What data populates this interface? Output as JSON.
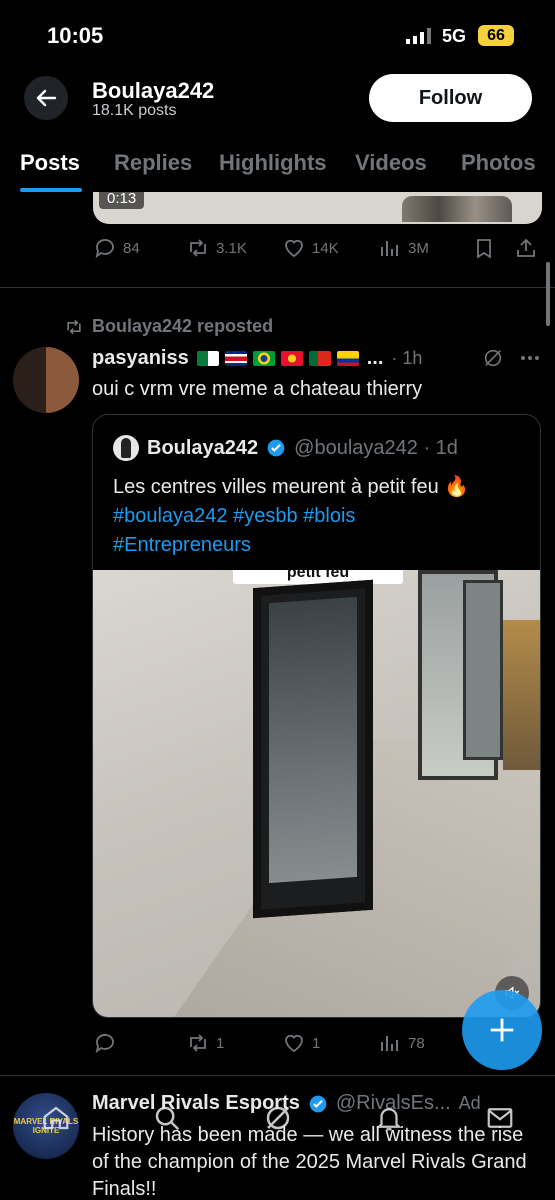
{
  "status_bar": {
    "time": "10:05",
    "network": "5G",
    "battery": "66"
  },
  "header": {
    "name": "Boulaya242",
    "posts": "18.1K posts",
    "follow_label": "Follow"
  },
  "tabs": [
    {
      "label": "Posts",
      "active": true
    },
    {
      "label": "Replies"
    },
    {
      "label": "Highlights"
    },
    {
      "label": "Videos"
    },
    {
      "label": "Photos"
    }
  ],
  "prev_post": {
    "media_duration": "0:13",
    "actions": {
      "replies": "84",
      "reposts": "3.1K",
      "likes": "14K",
      "views": "3M"
    }
  },
  "post": {
    "repost_label": "Boulaya242 reposted",
    "author_name": "pasyaniss",
    "author_ellipsis": "...",
    "time": "· 1h",
    "text": "oui c vrm vre meme a chateau thierry",
    "quote": {
      "name": "Boulaya242",
      "handle": "@boulaya242 · 1d",
      "text": "Les centres villes meurent à petit feu 🔥",
      "hashtags": "#boulaya242 #yesbb #blois",
      "hashtags2": "#Entrepreneurs",
      "media_caption": "petit feu"
    },
    "actions": {
      "reposts": "1",
      "likes": "1",
      "views": "78"
    }
  },
  "ad": {
    "avatar_text": "MARVEL RIVALS IGNITE",
    "name": "Marvel Rivals Esports",
    "handle": "@RivalsEs...",
    "label": "Ad",
    "text": "History has been made — we all witness the rise of the champion of the 2025 Marvel Rivals Grand Finals!!"
  },
  "colors": {
    "accent": "#1d9bf0",
    "muted": "#71767b",
    "background": "#000000"
  }
}
